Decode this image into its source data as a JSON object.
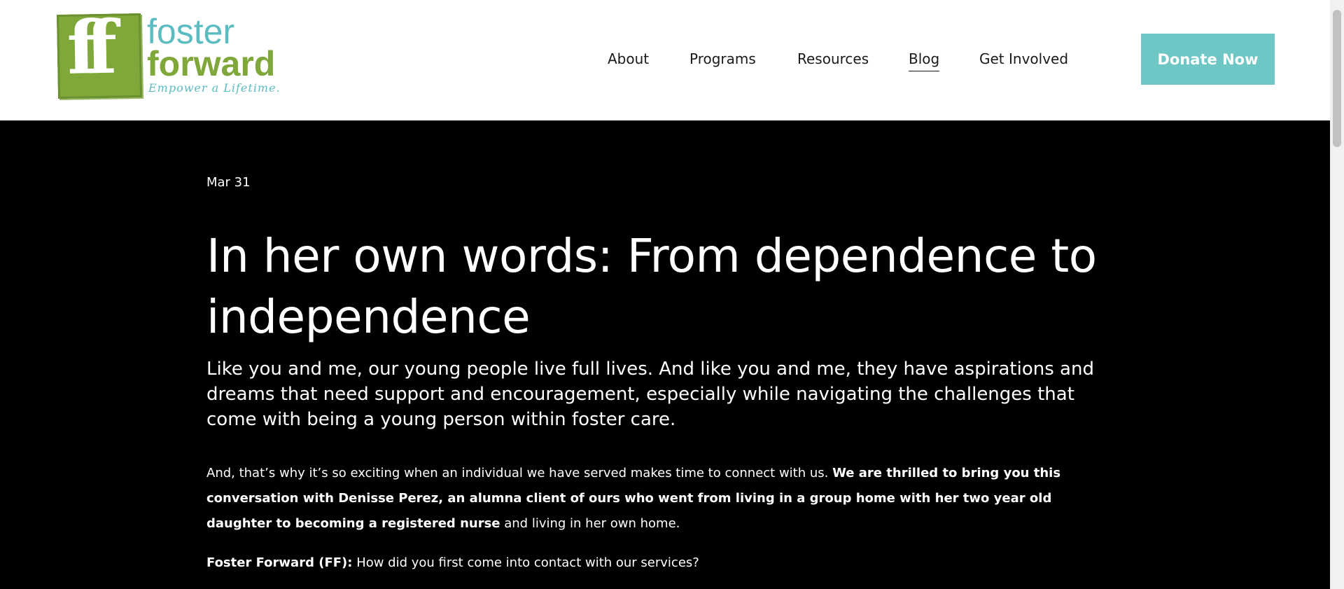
{
  "logo": {
    "mark_text": "ff",
    "word1": "foster",
    "word2": "forward",
    "tagline": "Empower a Lifetime."
  },
  "nav": {
    "items": [
      "About",
      "Programs",
      "Resources",
      "Blog",
      "Get Involved"
    ],
    "active": "Blog",
    "donate_label": "Donate Now"
  },
  "post": {
    "date": "Mar 31",
    "title": "In her own words: From dependence to independence",
    "lede": "Like you and me, our young people live full lives. And like you and me, they have aspirations and dreams that need support and encouragement, especially while navigating the challenges that come with being a young person within foster care.",
    "para_intro": "And, that’s why it’s so exciting when an individual we have served makes time to connect with us. ",
    "para_bold": "We are thrilled to bring you this conversation with Denisse Perez, an alumna client of ours who went from living in a group home with her two year old daughter to becoming a registered nurse",
    "para_end": " and living in her own home.",
    "q1_label": "Foster Forward (FF):",
    "q1_text": " How did you first come into contact with our services?"
  },
  "colors": {
    "teal": "#6ec6c5",
    "green": "#7fa73a",
    "logo_teal": "#5bbcc2",
    "background": "#000000"
  }
}
